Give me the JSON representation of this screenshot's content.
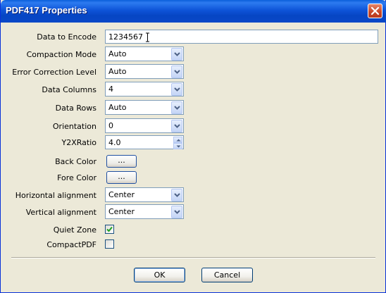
{
  "window": {
    "title": "PDF417 Properties"
  },
  "form": {
    "data_to_encode": {
      "label": "Data to Encode",
      "value": "1234567"
    },
    "compaction_mode": {
      "label": "Compaction Mode",
      "value": "Auto"
    },
    "error_correction_level": {
      "label": "Error Correction Level",
      "value": "Auto"
    },
    "data_columns": {
      "label": "Data Columns",
      "value": "4"
    },
    "data_rows": {
      "label": "Data Rows",
      "value": "Auto"
    },
    "orientation": {
      "label": "Orientation",
      "value": "0"
    },
    "y2x_ratio": {
      "label": "Y2XRatio",
      "value": "4.0"
    },
    "back_color": {
      "label": "Back Color",
      "button": "..."
    },
    "fore_color": {
      "label": "Fore Color",
      "button": "..."
    },
    "horizontal_alignment": {
      "label": "Horizontal alignment",
      "value": "Center"
    },
    "vertical_alignment": {
      "label": "Vertical alignment",
      "value": "Center"
    },
    "quiet_zone": {
      "label": "Quiet Zone",
      "checked": true
    },
    "compact_pdf": {
      "label": "CompactPDF",
      "checked": false
    }
  },
  "buttons": {
    "ok": "OK",
    "cancel": "Cancel"
  },
  "colors": {
    "title_bar": "#0A48C8",
    "dialog_bg": "#ECE9D8",
    "field_border": "#7F9DB9",
    "close_button": "#C84A2A"
  }
}
